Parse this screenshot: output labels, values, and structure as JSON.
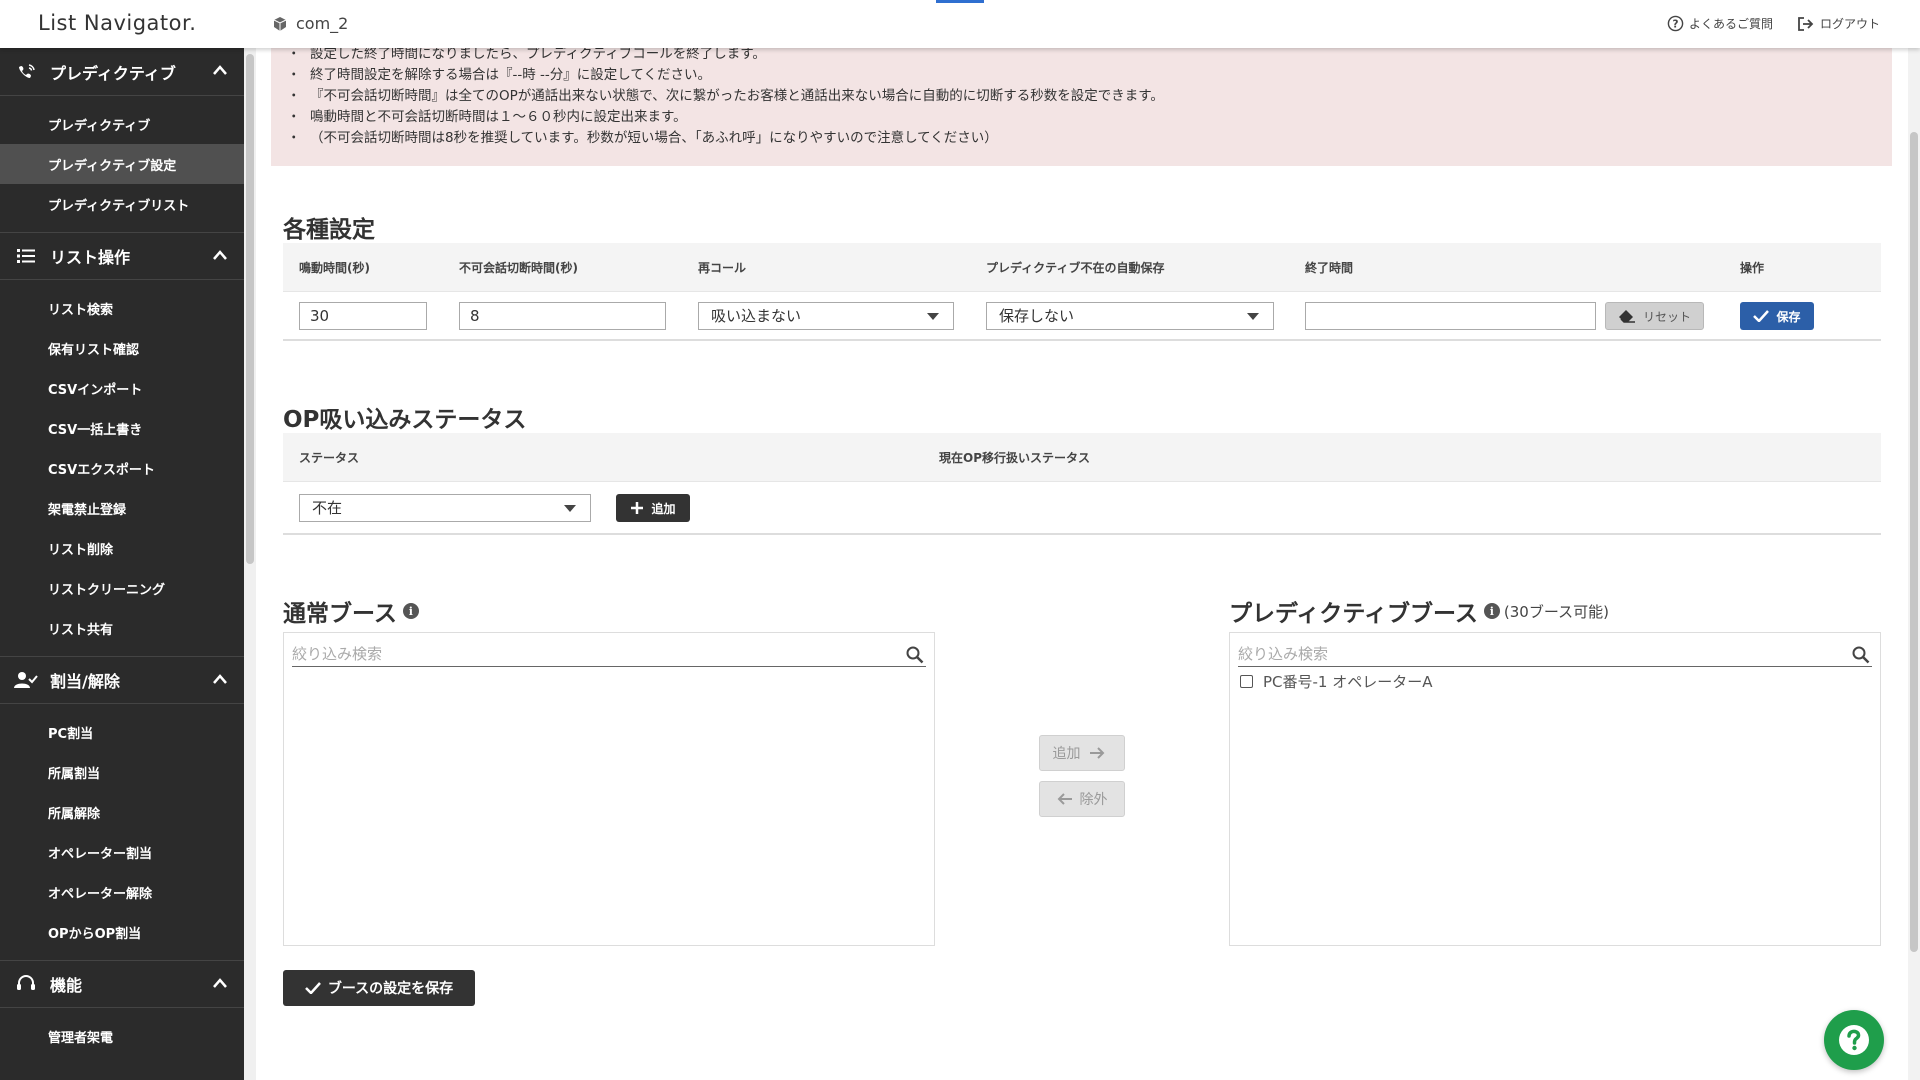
{
  "header": {
    "logo": "List Navigator.",
    "company": "com_2",
    "faq_label": "よくあるご質問",
    "logout_label": "ログアウト"
  },
  "sidebar": {
    "sections": [
      {
        "title": "プレディクティブ",
        "icon": "predictive-icon",
        "items": [
          "プレディクティブ",
          "プレディクティブ設定",
          "プレディクティブリスト"
        ]
      },
      {
        "title": "リスト操作",
        "icon": "list-icon",
        "items": [
          "リスト検索",
          "保有リスト確認",
          "CSVインポート",
          "CSV一括上書き",
          "CSVエクスポート",
          "架電禁止登録",
          "リスト削除",
          "リストクリーニング",
          "リスト共有"
        ]
      },
      {
        "title": "割当/解除",
        "icon": "user-check-icon",
        "items": [
          "PC割当",
          "所属割当",
          "所属解除",
          "オペレーター割当",
          "オペレーター解除",
          "OPからOP割当"
        ]
      },
      {
        "title": "機能",
        "icon": "headset-icon",
        "items": [
          "管理者架電"
        ]
      }
    ],
    "active_item": "プレディクティブ設定"
  },
  "notice": {
    "lines": [
      "設定した終了時間になりましたら、プレディクティブコールを終了します。",
      "終了時間設定を解除する場合は『--時 --分』に設定してください。",
      "『不可会話切断時間』は全てのOPが通話出来ない状態で、次に繋がったお客様と通話出来ない場合に自動的に切断する秒数を設定できます。",
      "鳴動時間と不可会話切断時間は１～６０秒内に設定出来ます。",
      "（不可会話切断時間は8秒を推奨しています。秒数が短い場合、「あふれ呼」になりやすいので注意してください）"
    ]
  },
  "settings": {
    "title": "各種設定",
    "headers": {
      "ring_time": "鳴動時間(秒)",
      "cutoff_time": "不可会話切断時間(秒)",
      "recall": "再コール",
      "auto_save": "プレディクティブ不在の自動保存",
      "end_time": "終了時間",
      "action": "操作"
    },
    "values": {
      "ring_time": "30",
      "cutoff_time": "8",
      "recall": "吸い込まない",
      "auto_save": "保存しない",
      "end_time": ""
    },
    "reset_label": "リセット",
    "save_label": "保存"
  },
  "op_status": {
    "title": "OP吸い込みステータス",
    "headers": {
      "status": "ステータス",
      "current": "現在OP移行扱いステータス"
    },
    "selected_status": "不在",
    "add_label": "追加"
  },
  "booths": {
    "normal": {
      "title": "通常ブース",
      "search_placeholder": "絞り込み検索",
      "items": []
    },
    "predictive": {
      "title": "プレディクティブブース",
      "note": "(30ブース可能)",
      "search_placeholder": "絞り込み検索",
      "items": [
        "PC番号-1 オペレーターA"
      ]
    },
    "add_label": "追加",
    "remove_label": "除外",
    "save_label": "ブースの設定を保存"
  },
  "colors": {
    "sidebar_bg": "#2b2b2b",
    "notice_bg": "#f3e4e4",
    "primary_blue": "#2c5fa8",
    "help_green": "#1f9e4b"
  }
}
